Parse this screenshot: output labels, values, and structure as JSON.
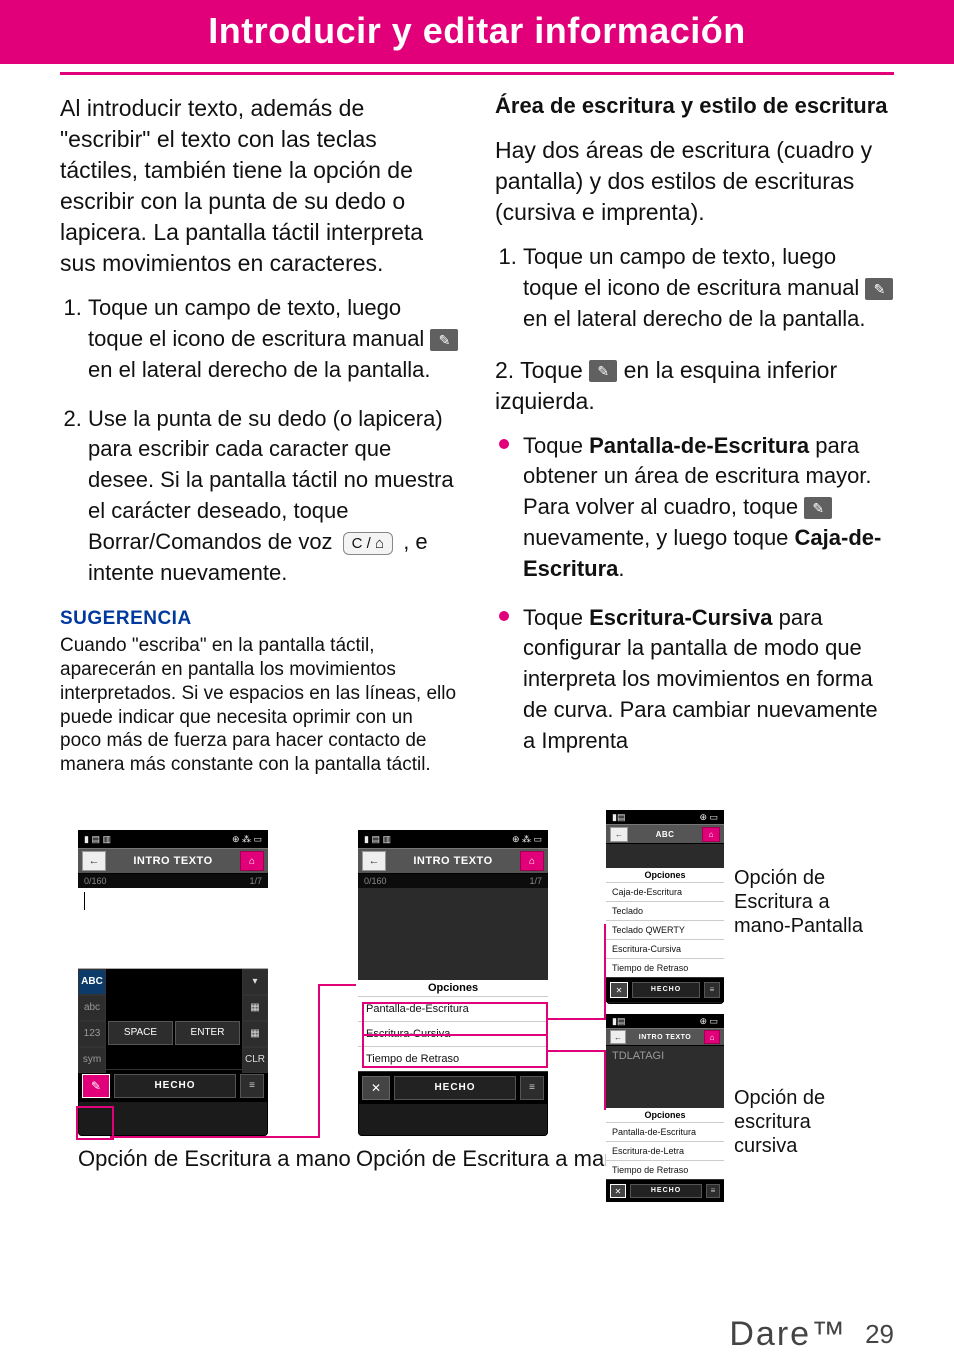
{
  "title": "Introducir y editar información",
  "left": {
    "intro": "Al introducir texto, además de \"escribir\" el texto con las teclas táctiles, también tiene la opción de escribir con la punta de su dedo o lapicera. La pantalla táctil interpreta sus movimientos en caracteres.",
    "step1_a": "Toque un campo de texto, luego toque el icono de escritura manual ",
    "step1_b": " en el lateral derecho de la pantalla.",
    "step2_a": "Use la punta de su dedo (o lapicera) para escribir cada caracter que desee. Si la pantalla táctil no muestra el carácter deseado, toque Borrar/Comandos de voz ",
    "clr_key": "C / ⌂",
    "step2_b": " , e intente nuevamente.",
    "tip_title": "SUGERENCIA",
    "tip_body": "Cuando \"escriba\" en la pantalla táctil, aparecerán en pantalla los movimientos interpretados. Si ve espacios en las líneas, ello puede indicar que necesita oprimir con un poco más de fuerza para hacer contacto de manera más constante con la pantalla táctil."
  },
  "right": {
    "h3": "Área de escritura y estilo de escritura",
    "p1": "Hay dos áreas de escritura (cuadro y pantalla) y dos estilos de escrituras (cursiva e imprenta).",
    "step1_a": "Toque un campo de texto, luego toque el icono de escritura manual ",
    "step1_b": " en el lateral derecho de la pantalla.",
    "step2_a": "2. Toque ",
    "step2_b": " en la esquina inferior izquierda.",
    "bul1_a": "Toque ",
    "bul1_b1": "Pantalla-de-Escritura",
    "bul1_c": " para obtener un área de escritura mayor. Para volver al cuadro, toque ",
    "bul1_d": " nuevamente, y luego toque ",
    "bul1_b2": "Caja-de-Escritura",
    "bul1_e": ".",
    "bul2_a": "Toque ",
    "bul2_b": "Escritura-Cursiva",
    "bul2_c": " para configurar la pantalla de modo que interpreta los movimientos en forma de curva. Para cambiar nuevamente a Imprenta"
  },
  "phone_common": {
    "intro_label": "INTRO TEXTO",
    "count_left": "0/160",
    "count_right": "1/7",
    "abc": "ABC",
    "abc_l": "abc",
    "n123": "123",
    "sym": "sym",
    "space": "SPACE",
    "enter": "ENTER",
    "clr": "CLR",
    "hecho": "HECHO",
    "opciones": "Opciones"
  },
  "phone2_opts": {
    "a": "Pantalla-de-Escritura",
    "b": "Escritura-Cursiva",
    "c": "Tiempo de Retraso"
  },
  "phone3_opts": {
    "a": "Caja-de-Escritura",
    "b": "Teclado",
    "c": "Teclado QWERTY",
    "d": "Escritura-Cursiva",
    "e": "Tiempo de Retraso"
  },
  "phone4": {
    "handwriting": "TDLATAGI",
    "a": "Pantalla-de-Escritura",
    "b": "Escritura-de-Letra",
    "c": "Tiempo de Retraso"
  },
  "captions": {
    "c1": "Opción de Escritura a mano",
    "c2": "Opción de Escritura a mano",
    "s1": "Opción de Escritura a mano-Pantalla",
    "s2": "Opción de escritura cursiva"
  },
  "footer": {
    "logo": "Dare™",
    "page": "29"
  }
}
